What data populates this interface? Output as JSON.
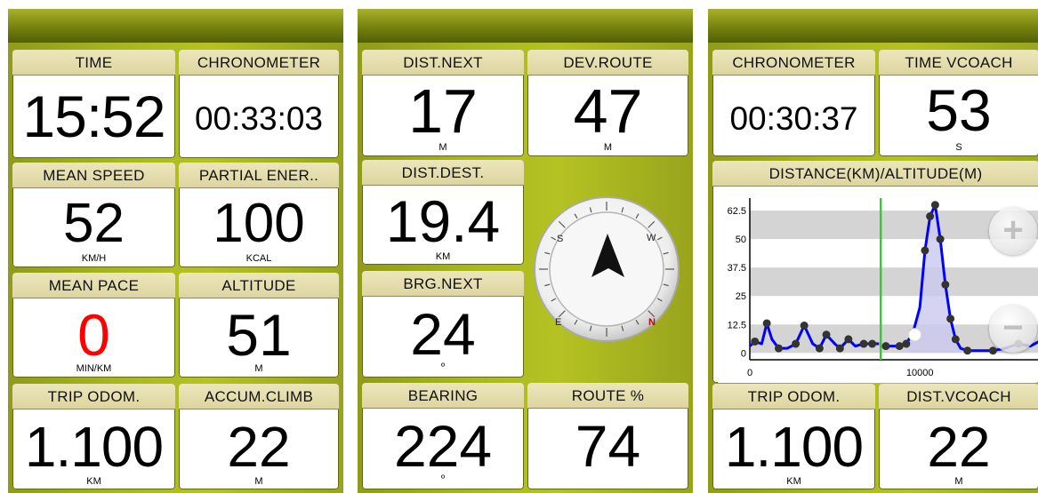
{
  "screens": [
    {
      "tiles": [
        {
          "label": "TIME",
          "value": "15:52",
          "unit": ""
        },
        {
          "label": "CHRONOMETER",
          "value": "00:33:03",
          "unit": ""
        },
        {
          "label": "MEAN SPEED",
          "value": "52",
          "unit": "KM/H"
        },
        {
          "label": "PARTIAL ENER..",
          "value": "100",
          "unit": "KCAL"
        },
        {
          "label": "MEAN PACE",
          "value": "0",
          "unit": "MIN/KM",
          "value_color": "#ff0000"
        },
        {
          "label": "ALTITUDE",
          "value": "51",
          "unit": "M"
        },
        {
          "label": "TRIP ODOM.",
          "value": "1.100",
          "unit": "KM"
        },
        {
          "label": "ACCUM.CLIMB",
          "value": "22",
          "unit": "M"
        }
      ]
    },
    {
      "tiles": [
        {
          "label": "DIST.NEXT",
          "value": "17",
          "unit": "M"
        },
        {
          "label": "DEV.ROUTE",
          "value": "47",
          "unit": "M"
        },
        {
          "label": "DIST.DEST.",
          "value": "19.4",
          "unit": "KM"
        },
        {
          "label": "BRG.NEXT",
          "value": "24",
          "unit": "º"
        },
        {
          "label": "BEARING",
          "value": "224",
          "unit": "º"
        },
        {
          "label": "ROUTE %",
          "value": "74",
          "unit": ""
        }
      ],
      "compass": {
        "letters": [
          "S",
          "W",
          "E",
          "N"
        ],
        "north_color": "#cc0000"
      }
    },
    {
      "tiles": [
        {
          "label": "CHRONOMETER",
          "value": "00:30:37",
          "unit": ""
        },
        {
          "label": "TIME VCOACH",
          "value": "53",
          "unit": "S"
        },
        {
          "label": "TRIP ODOM.",
          "value": "1.100",
          "unit": "KM"
        },
        {
          "label": "DIST.VCOACH",
          "value": "22",
          "unit": "M"
        }
      ],
      "chart": {
        "title": "DISTANCE(KM)/ALTITUDE(M)",
        "y_ticks": [
          "62.5",
          "50",
          "37.5",
          "25",
          "12.5",
          "0"
        ],
        "x_ticks": [
          "0",
          "10000"
        ],
        "zoom_in_icon": "zoom-in-icon",
        "zoom_out_icon": "zoom-out-icon"
      }
    }
  ],
  "chart_data": {
    "type": "line",
    "title": "DISTANCE(KM)/ALTITUDE(M)",
    "xlabel": "",
    "ylabel": "",
    "xlim": [
      0,
      17000
    ],
    "ylim": [
      -3,
      68
    ],
    "y_ticks": [
      62.5,
      50,
      37.5,
      25,
      12.5,
      0
    ],
    "x_ticks": [
      0,
      10000
    ],
    "series": [
      {
        "color": "#0000ff",
        "x": [
          0,
          300,
          700,
          1000,
          1300,
          1700,
          2200,
          2700,
          3200,
          3700,
          4100,
          4500,
          5000,
          5300,
          5800,
          6200,
          6700,
          7200,
          7600,
          7700,
          8000,
          8400,
          8800,
          9200,
          9600,
          10000,
          10300,
          10600,
          10900,
          11200,
          11500,
          11800,
          12100,
          12400,
          12800,
          13300,
          13800,
          14300,
          15000,
          15800,
          16500,
          17000
        ],
        "y": [
          3,
          5,
          4,
          13,
          6,
          2,
          2,
          4,
          12,
          4,
          2,
          8,
          4,
          2,
          6,
          3,
          4,
          4,
          4,
          null,
          3,
          3,
          3,
          4,
          9,
          20,
          45,
          60,
          65,
          50,
          30,
          15,
          6,
          2,
          1,
          1,
          1,
          1,
          2,
          4,
          3,
          5
        ]
      }
    ],
    "markers": {
      "color": "#333333",
      "x": [
        300,
        1000,
        1700,
        2700,
        3200,
        4100,
        4500,
        5300,
        5800,
        6700,
        7200,
        8000,
        8800,
        9200,
        9600,
        10300,
        10600,
        10900,
        11200,
        11500,
        11800,
        12100,
        12800,
        14300,
        15800
      ],
      "y": [
        5,
        13,
        2,
        4,
        12,
        2,
        8,
        2,
        6,
        4,
        4,
        3,
        3,
        4,
        9,
        45,
        60,
        65,
        50,
        30,
        15,
        6,
        1,
        1,
        4
      ]
    },
    "current_position": {
      "x": 7700,
      "color": "#33cc33"
    },
    "position_marker": {
      "x": 9700,
      "y": 8
    }
  }
}
